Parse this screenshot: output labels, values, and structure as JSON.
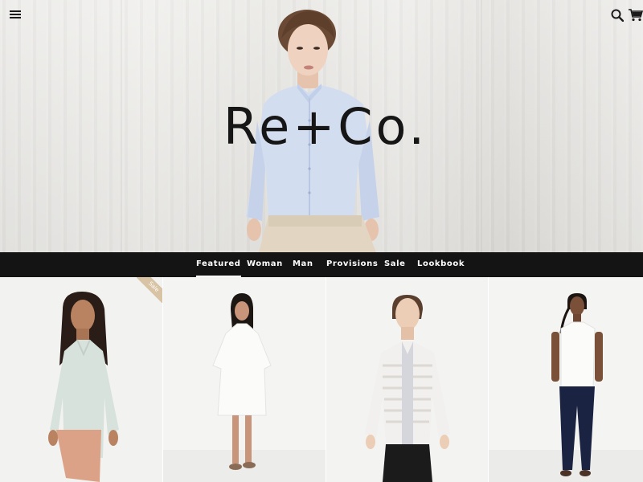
{
  "header": {
    "menu_icon": "hamburger-menu-icon",
    "search_icon": "search-icon",
    "cart_icon": "shopping-cart-icon"
  },
  "hero": {
    "brand_name": "Re+Co."
  },
  "nav": {
    "items": [
      {
        "label": "Featured",
        "active": true
      },
      {
        "label": "Woman",
        "active": false
      },
      {
        "label": "Man",
        "active": false
      },
      {
        "label": "Provisions",
        "active": false
      },
      {
        "label": "Sale",
        "active": false
      },
      {
        "label": "Lookbook",
        "active": false
      }
    ]
  },
  "products": [
    {
      "badge": "Sale"
    },
    {
      "badge": ""
    },
    {
      "badge": ""
    },
    {
      "badge": ""
    }
  ],
  "colors": {
    "nav_background": "#141414",
    "nav_text": "#ffffff",
    "sale_ribbon": "#d8c3a5",
    "brand_text": "#161616"
  }
}
